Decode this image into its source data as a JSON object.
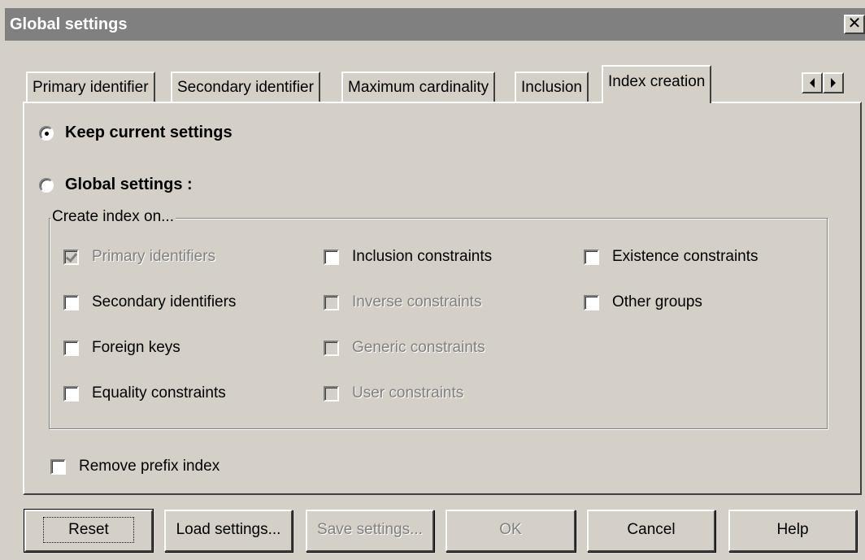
{
  "window": {
    "title": "Global settings",
    "close_label": "✕"
  },
  "tabs": [
    {
      "label": "Primary identifier"
    },
    {
      "label": "Secondary identifier"
    },
    {
      "label": "Maximum cardinality"
    },
    {
      "label": "Inclusion"
    },
    {
      "label": "Index creation",
      "active": true
    }
  ],
  "options": {
    "keep_current": {
      "label": "Keep current settings",
      "checked": true
    },
    "global": {
      "label": "Global settings :",
      "checked": false
    }
  },
  "group": {
    "legend": "Create index on...",
    "col1": [
      {
        "label": "Primary identifiers",
        "checked": true,
        "disabled": true
      },
      {
        "label": "Secondary identifiers",
        "checked": false,
        "disabled": false
      },
      {
        "label": "Foreign keys",
        "checked": false,
        "disabled": false
      },
      {
        "label": "Equality constraints",
        "checked": false,
        "disabled": false
      }
    ],
    "col2": [
      {
        "label": "Inclusion constraints",
        "checked": false,
        "disabled": false
      },
      {
        "label": "Inverse constraints",
        "checked": false,
        "disabled": true
      },
      {
        "label": "Generic constraints",
        "checked": false,
        "disabled": true
      },
      {
        "label": "User constraints",
        "checked": false,
        "disabled": true
      }
    ],
    "col3": [
      {
        "label": "Existence constraints",
        "checked": false,
        "disabled": false
      },
      {
        "label": "Other groups",
        "checked": false,
        "disabled": false
      }
    ]
  },
  "remove_prefix": {
    "label": "Remove prefix index",
    "checked": false
  },
  "buttons": {
    "reset": "Reset",
    "load": "Load settings...",
    "save": "Save settings...",
    "ok": "OK",
    "cancel": "Cancel",
    "help": "Help"
  }
}
